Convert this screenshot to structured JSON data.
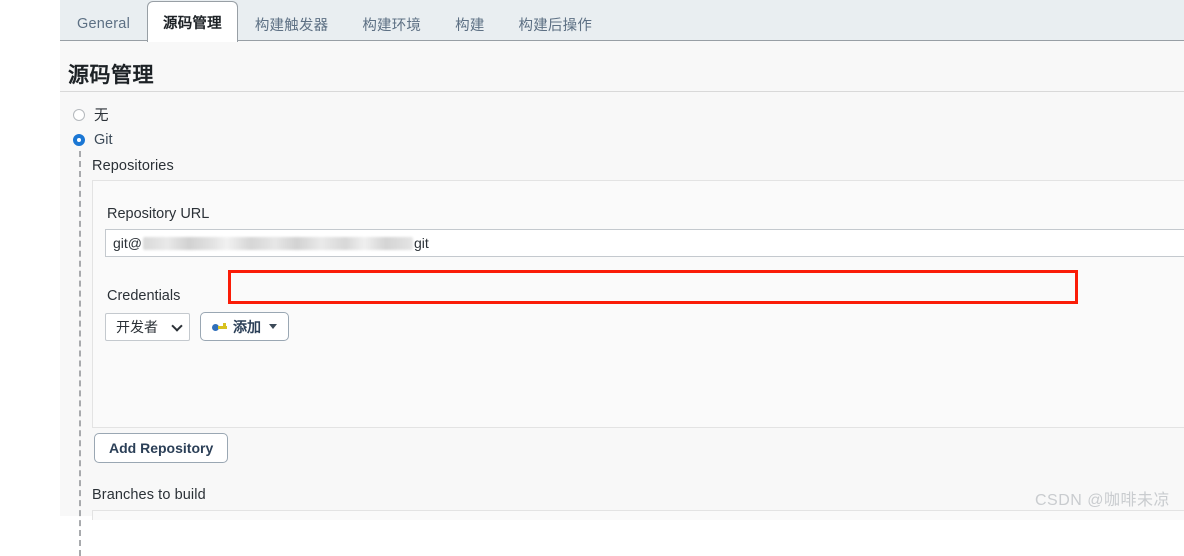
{
  "tabs": [
    {
      "label": "General",
      "active": false
    },
    {
      "label": "源码管理",
      "active": true
    },
    {
      "label": "构建触发器",
      "active": false
    },
    {
      "label": "构建环境",
      "active": false
    },
    {
      "label": "构建",
      "active": false
    },
    {
      "label": "构建后操作",
      "active": false
    }
  ],
  "section": {
    "title": "源码管理"
  },
  "scm_options": [
    {
      "label": "无",
      "selected": false
    },
    {
      "label": "Git",
      "selected": true
    }
  ],
  "repositories": {
    "group_label": "Repositories",
    "repository_url": {
      "label": "Repository URL",
      "value_prefix": "git@",
      "value_suffix": "git",
      "redacted": true
    },
    "credentials": {
      "label": "Credentials",
      "selected": "开发者",
      "add_button": {
        "label": "添加",
        "icon": "key-icon",
        "caret": "caret-down-icon"
      }
    },
    "add_repository_button": "Add Repository"
  },
  "branches": {
    "group_label": "Branches to build"
  },
  "annotation": {
    "type": "rectangle-highlight",
    "color": "#fa1c07"
  },
  "watermark": "CSDN @咖啡未凉",
  "colors": {
    "tabbar_bg": "#e9eef1",
    "content_bg": "#f8f8f8",
    "panel_bg": "#fafafa",
    "radio_selected": "#1b77d4",
    "annotation_red": "#fa1c07",
    "button_text": "#2b3f57"
  }
}
